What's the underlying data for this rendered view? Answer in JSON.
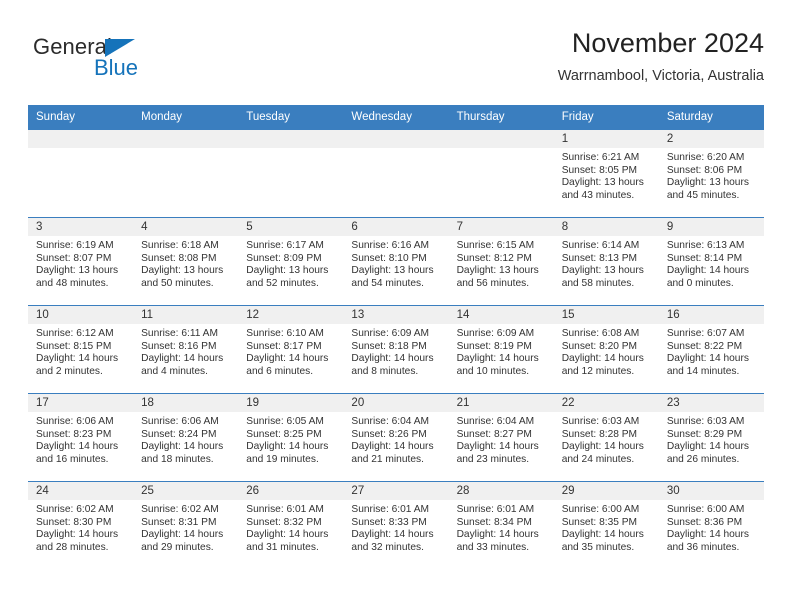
{
  "brand": {
    "name_part1": "General",
    "name_part2": "Blue",
    "accent_color": "#1573ba"
  },
  "header": {
    "title": "November 2024",
    "subtitle": "Warrnambool, Victoria, Australia"
  },
  "theme": {
    "header_blue": "#3a7ebf",
    "daynum_band": "#f0f0f0",
    "text": "#333333"
  },
  "weekday_headers": [
    "Sunday",
    "Monday",
    "Tuesday",
    "Wednesday",
    "Thursday",
    "Friday",
    "Saturday"
  ],
  "labels": {
    "sunrise_prefix": "Sunrise:",
    "sunset_prefix": "Sunset:",
    "daylight_prefix": "Daylight:"
  },
  "weeks": [
    [
      {
        "day": "",
        "sunrise": "",
        "sunset": "",
        "daylight_line1": "",
        "daylight_line2": ""
      },
      {
        "day": "",
        "sunrise": "",
        "sunset": "",
        "daylight_line1": "",
        "daylight_line2": ""
      },
      {
        "day": "",
        "sunrise": "",
        "sunset": "",
        "daylight_line1": "",
        "daylight_line2": ""
      },
      {
        "day": "",
        "sunrise": "",
        "sunset": "",
        "daylight_line1": "",
        "daylight_line2": ""
      },
      {
        "day": "",
        "sunrise": "",
        "sunset": "",
        "daylight_line1": "",
        "daylight_line2": ""
      },
      {
        "day": "1",
        "sunrise": "Sunrise: 6:21 AM",
        "sunset": "Sunset: 8:05 PM",
        "daylight_line1": "Daylight: 13 hours",
        "daylight_line2": "and 43 minutes."
      },
      {
        "day": "2",
        "sunrise": "Sunrise: 6:20 AM",
        "sunset": "Sunset: 8:06 PM",
        "daylight_line1": "Daylight: 13 hours",
        "daylight_line2": "and 45 minutes."
      }
    ],
    [
      {
        "day": "3",
        "sunrise": "Sunrise: 6:19 AM",
        "sunset": "Sunset: 8:07 PM",
        "daylight_line1": "Daylight: 13 hours",
        "daylight_line2": "and 48 minutes."
      },
      {
        "day": "4",
        "sunrise": "Sunrise: 6:18 AM",
        "sunset": "Sunset: 8:08 PM",
        "daylight_line1": "Daylight: 13 hours",
        "daylight_line2": "and 50 minutes."
      },
      {
        "day": "5",
        "sunrise": "Sunrise: 6:17 AM",
        "sunset": "Sunset: 8:09 PM",
        "daylight_line1": "Daylight: 13 hours",
        "daylight_line2": "and 52 minutes."
      },
      {
        "day": "6",
        "sunrise": "Sunrise: 6:16 AM",
        "sunset": "Sunset: 8:10 PM",
        "daylight_line1": "Daylight: 13 hours",
        "daylight_line2": "and 54 minutes."
      },
      {
        "day": "7",
        "sunrise": "Sunrise: 6:15 AM",
        "sunset": "Sunset: 8:12 PM",
        "daylight_line1": "Daylight: 13 hours",
        "daylight_line2": "and 56 minutes."
      },
      {
        "day": "8",
        "sunrise": "Sunrise: 6:14 AM",
        "sunset": "Sunset: 8:13 PM",
        "daylight_line1": "Daylight: 13 hours",
        "daylight_line2": "and 58 minutes."
      },
      {
        "day": "9",
        "sunrise": "Sunrise: 6:13 AM",
        "sunset": "Sunset: 8:14 PM",
        "daylight_line1": "Daylight: 14 hours",
        "daylight_line2": "and 0 minutes."
      }
    ],
    [
      {
        "day": "10",
        "sunrise": "Sunrise: 6:12 AM",
        "sunset": "Sunset: 8:15 PM",
        "daylight_line1": "Daylight: 14 hours",
        "daylight_line2": "and 2 minutes."
      },
      {
        "day": "11",
        "sunrise": "Sunrise: 6:11 AM",
        "sunset": "Sunset: 8:16 PM",
        "daylight_line1": "Daylight: 14 hours",
        "daylight_line2": "and 4 minutes."
      },
      {
        "day": "12",
        "sunrise": "Sunrise: 6:10 AM",
        "sunset": "Sunset: 8:17 PM",
        "daylight_line1": "Daylight: 14 hours",
        "daylight_line2": "and 6 minutes."
      },
      {
        "day": "13",
        "sunrise": "Sunrise: 6:09 AM",
        "sunset": "Sunset: 8:18 PM",
        "daylight_line1": "Daylight: 14 hours",
        "daylight_line2": "and 8 minutes."
      },
      {
        "day": "14",
        "sunrise": "Sunrise: 6:09 AM",
        "sunset": "Sunset: 8:19 PM",
        "daylight_line1": "Daylight: 14 hours",
        "daylight_line2": "and 10 minutes."
      },
      {
        "day": "15",
        "sunrise": "Sunrise: 6:08 AM",
        "sunset": "Sunset: 8:20 PM",
        "daylight_line1": "Daylight: 14 hours",
        "daylight_line2": "and 12 minutes."
      },
      {
        "day": "16",
        "sunrise": "Sunrise: 6:07 AM",
        "sunset": "Sunset: 8:22 PM",
        "daylight_line1": "Daylight: 14 hours",
        "daylight_line2": "and 14 minutes."
      }
    ],
    [
      {
        "day": "17",
        "sunrise": "Sunrise: 6:06 AM",
        "sunset": "Sunset: 8:23 PM",
        "daylight_line1": "Daylight: 14 hours",
        "daylight_line2": "and 16 minutes."
      },
      {
        "day": "18",
        "sunrise": "Sunrise: 6:06 AM",
        "sunset": "Sunset: 8:24 PM",
        "daylight_line1": "Daylight: 14 hours",
        "daylight_line2": "and 18 minutes."
      },
      {
        "day": "19",
        "sunrise": "Sunrise: 6:05 AM",
        "sunset": "Sunset: 8:25 PM",
        "daylight_line1": "Daylight: 14 hours",
        "daylight_line2": "and 19 minutes."
      },
      {
        "day": "20",
        "sunrise": "Sunrise: 6:04 AM",
        "sunset": "Sunset: 8:26 PM",
        "daylight_line1": "Daylight: 14 hours",
        "daylight_line2": "and 21 minutes."
      },
      {
        "day": "21",
        "sunrise": "Sunrise: 6:04 AM",
        "sunset": "Sunset: 8:27 PM",
        "daylight_line1": "Daylight: 14 hours",
        "daylight_line2": "and 23 minutes."
      },
      {
        "day": "22",
        "sunrise": "Sunrise: 6:03 AM",
        "sunset": "Sunset: 8:28 PM",
        "daylight_line1": "Daylight: 14 hours",
        "daylight_line2": "and 24 minutes."
      },
      {
        "day": "23",
        "sunrise": "Sunrise: 6:03 AM",
        "sunset": "Sunset: 8:29 PM",
        "daylight_line1": "Daylight: 14 hours",
        "daylight_line2": "and 26 minutes."
      }
    ],
    [
      {
        "day": "24",
        "sunrise": "Sunrise: 6:02 AM",
        "sunset": "Sunset: 8:30 PM",
        "daylight_line1": "Daylight: 14 hours",
        "daylight_line2": "and 28 minutes."
      },
      {
        "day": "25",
        "sunrise": "Sunrise: 6:02 AM",
        "sunset": "Sunset: 8:31 PM",
        "daylight_line1": "Daylight: 14 hours",
        "daylight_line2": "and 29 minutes."
      },
      {
        "day": "26",
        "sunrise": "Sunrise: 6:01 AM",
        "sunset": "Sunset: 8:32 PM",
        "daylight_line1": "Daylight: 14 hours",
        "daylight_line2": "and 31 minutes."
      },
      {
        "day": "27",
        "sunrise": "Sunrise: 6:01 AM",
        "sunset": "Sunset: 8:33 PM",
        "daylight_line1": "Daylight: 14 hours",
        "daylight_line2": "and 32 minutes."
      },
      {
        "day": "28",
        "sunrise": "Sunrise: 6:01 AM",
        "sunset": "Sunset: 8:34 PM",
        "daylight_line1": "Daylight: 14 hours",
        "daylight_line2": "and 33 minutes."
      },
      {
        "day": "29",
        "sunrise": "Sunrise: 6:00 AM",
        "sunset": "Sunset: 8:35 PM",
        "daylight_line1": "Daylight: 14 hours",
        "daylight_line2": "and 35 minutes."
      },
      {
        "day": "30",
        "sunrise": "Sunrise: 6:00 AM",
        "sunset": "Sunset: 8:36 PM",
        "daylight_line1": "Daylight: 14 hours",
        "daylight_line2": "and 36 minutes."
      }
    ]
  ]
}
